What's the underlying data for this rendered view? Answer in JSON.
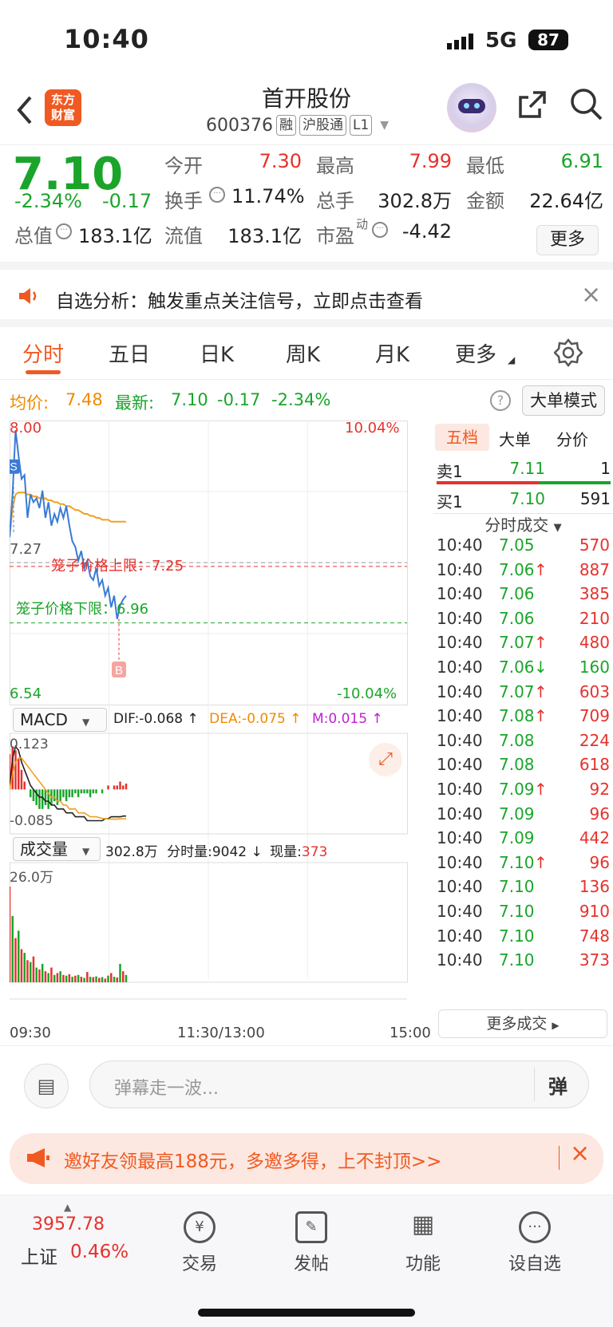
{
  "status": {
    "time": "10:40",
    "network": "5G",
    "battery": "87"
  },
  "header": {
    "back_icon": "chevron-left-icon",
    "logo_text": "东方\n财富",
    "title": "首开股份",
    "code": "600376",
    "tags": [
      "融",
      "沪股通",
      "L1"
    ],
    "share_icon": "share-icon",
    "search_icon": "search-icon"
  },
  "quote": {
    "price": "7.10",
    "change_pct": "-2.34%",
    "change": "-0.17",
    "open_label": "今开",
    "open": "7.30",
    "high_label": "最高",
    "high": "7.99",
    "low_label": "最低",
    "low": "6.91",
    "turnover_label": "换手",
    "turnover": "11.74%",
    "volume_label": "总手",
    "volume": "302.8万",
    "amount_label": "金额",
    "amount": "22.64亿",
    "mktcap_label": "总值",
    "mktcap": "183.1亿",
    "float_label": "流值",
    "float": "183.1亿",
    "pe_label": "市盈",
    "pe_sup": "动",
    "pe": "-4.42",
    "more": "更多"
  },
  "notice": {
    "text": "自选分析：触发重点关注信号，立即点击查看",
    "close": "×"
  },
  "tabs": {
    "items": [
      "分时",
      "五日",
      "日K",
      "周K",
      "月K",
      "更多"
    ],
    "active": "分时"
  },
  "infobar": {
    "avg_label": "均价:",
    "avg": "7.48",
    "latest_label": "最新:",
    "latest": "7.10",
    "change": "-0.17",
    "change_pct": "-2.34%",
    "big_mode": "大单模式"
  },
  "chart_data": {
    "type": "line",
    "price_axis": {
      "max": "8.00",
      "mid": "7.27",
      "min": "6.54",
      "max_pct": "10.04%",
      "min_pct": "-10.04%"
    },
    "upper_limit_label": "笼子价格上限：",
    "upper_limit": "7.25",
    "lower_limit_label": "笼子价格下限：",
    "lower_limit": "6.96",
    "markers": {
      "sell": "S",
      "buy": "B"
    },
    "price_series": [
      7.4,
      7.62,
      7.95,
      7.82,
      7.7,
      7.72,
      7.5,
      7.62,
      7.58,
      7.6,
      7.55,
      7.64,
      7.5,
      7.58,
      7.46,
      7.52,
      7.48,
      7.55,
      7.5,
      7.56,
      7.46,
      7.38,
      7.35,
      7.28,
      7.33,
      7.24,
      7.28,
      7.2,
      7.18,
      7.24,
      7.15,
      7.18,
      7.1,
      7.14,
      7.04,
      7.1,
      6.98,
      7.05,
      7.08,
      7.1
    ],
    "avg_series": [
      7.4,
      7.55,
      7.62,
      7.63,
      7.63,
      7.63,
      7.62,
      7.62,
      7.61,
      7.61,
      7.6,
      7.6,
      7.6,
      7.59,
      7.59,
      7.58,
      7.58,
      7.57,
      7.57,
      7.56,
      7.56,
      7.55,
      7.54,
      7.54,
      7.53,
      7.52,
      7.52,
      7.51,
      7.51,
      7.5,
      7.5,
      7.49,
      7.49,
      7.49,
      7.48,
      7.48,
      7.48,
      7.48,
      7.48,
      7.48
    ],
    "time_labels": [
      "09:30",
      "11:30/13:00",
      "15:00"
    ],
    "macd": {
      "label": "MACD",
      "dif_label": "DIF:",
      "dif": "-0.068",
      "dea_label": "DEA:",
      "dea": "-0.075",
      "m_label": "M:",
      "m": "0.015",
      "ymax": "0.123",
      "ymin": "-0.085",
      "bars": [
        0.09,
        0.11,
        0.1,
        0.08,
        0.05,
        0.02,
        0.0,
        -0.02,
        -0.03,
        -0.04,
        -0.05,
        -0.05,
        -0.04,
        -0.05,
        -0.04,
        -0.03,
        -0.04,
        -0.03,
        -0.02,
        -0.03,
        -0.02,
        -0.02,
        -0.01,
        -0.02,
        -0.01,
        -0.01,
        -0.01,
        -0.02,
        -0.01,
        -0.01,
        0.0,
        -0.01,
        0.0,
        0.01,
        0.0,
        0.01,
        0.01,
        0.02,
        0.01,
        0.015
      ],
      "dif_series": [
        0.0,
        0.08,
        0.11,
        0.1,
        0.07,
        0.05,
        0.03,
        0.01,
        0.0,
        -0.01,
        -0.02,
        -0.02,
        -0.03,
        -0.03,
        -0.04,
        -0.04,
        -0.05,
        -0.05,
        -0.05,
        -0.06,
        -0.06,
        -0.06,
        -0.07,
        -0.07,
        -0.07,
        -0.07,
        -0.08,
        -0.08,
        -0.08,
        -0.08,
        -0.08,
        -0.08,
        -0.075,
        -0.075,
        -0.07,
        -0.07,
        -0.07,
        -0.07,
        -0.068,
        -0.068
      ],
      "dea_series": [
        0.0,
        0.04,
        0.07,
        0.08,
        0.08,
        0.07,
        0.06,
        0.05,
        0.04,
        0.03,
        0.02,
        0.01,
        0.0,
        -0.01,
        -0.02,
        -0.02,
        -0.03,
        -0.03,
        -0.04,
        -0.04,
        -0.05,
        -0.05,
        -0.05,
        -0.06,
        -0.06,
        -0.06,
        -0.065,
        -0.07,
        -0.07,
        -0.07,
        -0.072,
        -0.074,
        -0.075,
        -0.076,
        -0.076,
        -0.076,
        -0.076,
        -0.075,
        -0.075,
        -0.075
      ]
    },
    "volume": {
      "label": "成交量",
      "total": "302.8万",
      "minute_label": "分时量:",
      "minute": "9042",
      "current_label": "现量:",
      "current": "373",
      "ymax": "26.0万",
      "bars": [
        26.0,
        18.0,
        12.0,
        14.0,
        9.0,
        8.0,
        6.0,
        5.5,
        7.0,
        4.0,
        3.5,
        5.0,
        3.0,
        2.5,
        4.0,
        2.0,
        2.5,
        3.0,
        2.0,
        1.8,
        2.2,
        1.5,
        1.8,
        2.0,
        1.5,
        1.2,
        2.8,
        1.5,
        1.4,
        1.6,
        1.2,
        1.4,
        1.0,
        1.8,
        2.5,
        1.5,
        1.3,
        5.0,
        3.0,
        2.0
      ]
    }
  },
  "orderbook": {
    "tabs": [
      "五档",
      "大单",
      "分价"
    ],
    "sell1_label": "卖1",
    "sell1_price": "7.11",
    "sell1_vol": "1",
    "buy1_label": "买1",
    "buy1_price": "7.10",
    "buy1_vol": "591",
    "section_title": "分时成交",
    "trades": [
      {
        "t": "10:40",
        "p": "7.05",
        "v": "570",
        "a": ""
      },
      {
        "t": "10:40",
        "p": "7.06",
        "v": "887",
        "a": "↑"
      },
      {
        "t": "10:40",
        "p": "7.06",
        "v": "385",
        "a": ""
      },
      {
        "t": "10:40",
        "p": "7.06",
        "v": "210",
        "a": ""
      },
      {
        "t": "10:40",
        "p": "7.07",
        "v": "480",
        "a": "↑"
      },
      {
        "t": "10:40",
        "p": "7.06",
        "v": "160",
        "a": "↓"
      },
      {
        "t": "10:40",
        "p": "7.07",
        "v": "603",
        "a": "↑"
      },
      {
        "t": "10:40",
        "p": "7.08",
        "v": "709",
        "a": "↑"
      },
      {
        "t": "10:40",
        "p": "7.08",
        "v": "224",
        "a": ""
      },
      {
        "t": "10:40",
        "p": "7.08",
        "v": "618",
        "a": ""
      },
      {
        "t": "10:40",
        "p": "7.09",
        "v": "92",
        "a": "↑"
      },
      {
        "t": "10:40",
        "p": "7.09",
        "v": "96",
        "a": ""
      },
      {
        "t": "10:40",
        "p": "7.09",
        "v": "442",
        "a": ""
      },
      {
        "t": "10:40",
        "p": "7.10",
        "v": "96",
        "a": "↑"
      },
      {
        "t": "10:40",
        "p": "7.10",
        "v": "136",
        "a": ""
      },
      {
        "t": "10:40",
        "p": "7.10",
        "v": "910",
        "a": ""
      },
      {
        "t": "10:40",
        "p": "7.10",
        "v": "748",
        "a": ""
      },
      {
        "t": "10:40",
        "p": "7.10",
        "v": "373",
        "a": ""
      }
    ],
    "more_trades": "更多成交"
  },
  "comment": {
    "placeholder": "弹幕走一波...",
    "danmu": "弹"
  },
  "promo": {
    "text": "邀好友领最高188元，多邀多得，上不封顶>>",
    "close": "×"
  },
  "bottom": {
    "index_value": "3957.78",
    "index_name": "上证",
    "index_pct": "0.46%",
    "items": [
      {
        "label": "交易",
        "icon": "yen-exchange-icon",
        "glyph": "¥"
      },
      {
        "label": "发帖",
        "icon": "edit-icon",
        "glyph": "✎"
      },
      {
        "label": "功能",
        "icon": "grid-icon",
        "glyph": "▦"
      },
      {
        "label": "设自选",
        "icon": "more-dots-icon",
        "glyph": "···"
      }
    ]
  },
  "colors": {
    "red": "#e5322d",
    "green": "#1aa52a",
    "orange": "#f08a00",
    "accent": "#f05a22"
  }
}
